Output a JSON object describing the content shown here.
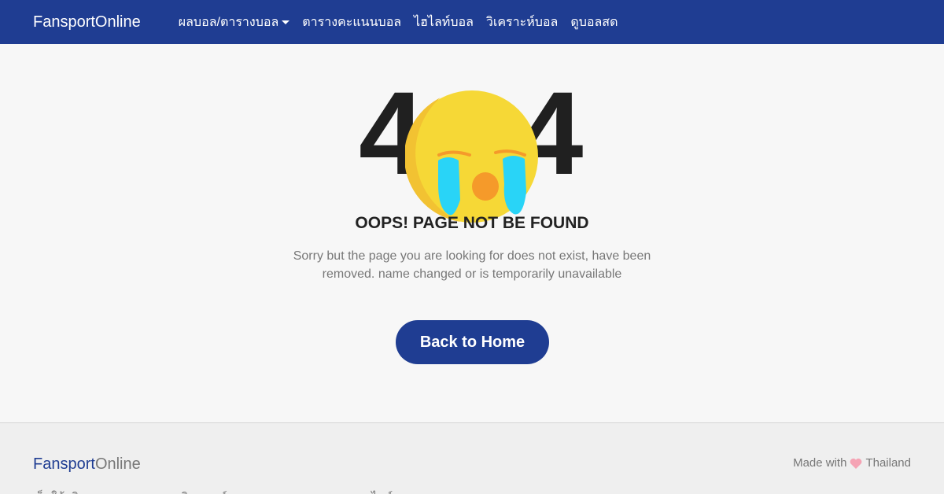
{
  "navbar": {
    "brand": "FansportOnline",
    "items": [
      {
        "label": "ผลบอล/ตารางบอล",
        "dropdown": true
      },
      {
        "label": "ตารางคะแนนบอล"
      },
      {
        "label": "ไฮไลท์บอล"
      },
      {
        "label": "วิเคราะห์บอล"
      },
      {
        "label": "ดูบอลสด"
      }
    ]
  },
  "error": {
    "code_left": "4",
    "code_right": "4",
    "emoji": "crying-face-icon",
    "title": "OOPS! PAGE NOT BE FOUND",
    "description": "Sorry but the page you are looking for does not exist, have been removed. name changed or is temporarily unavailable",
    "button_label": "Back to Home"
  },
  "footer": {
    "brand_part1": "Fansport",
    "brand_part2": "Online",
    "made_with_prefix": "Made with",
    "made_with_suffix": "Thailand",
    "description": "เว็บให้บริการรายงาน ผลบอล วิเคราะห์บอล ราคาบอล ดูบอลสดออนไลน์"
  },
  "colors": {
    "primary": "#1f3d92",
    "background": "#f7f7f7",
    "heart": "#f5a3b4",
    "emoji_face": "#f6d836",
    "emoji_tear": "#29d4f7",
    "emoji_mouth": "#f59a2a"
  }
}
